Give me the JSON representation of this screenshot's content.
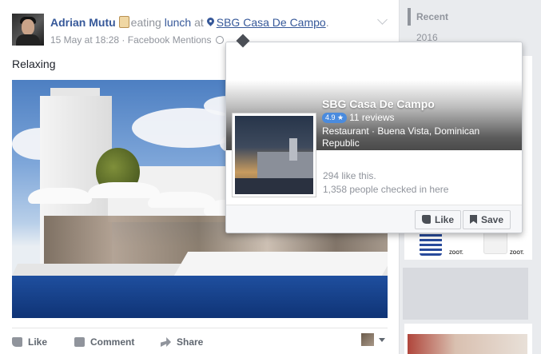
{
  "post": {
    "author": "Adrian Mutu",
    "activity": "eating",
    "activity_object": "lunch",
    "at_word": "at",
    "place": "SBG Casa De Campo",
    "period": ".",
    "timestamp": "15 May at 18:28",
    "separator": " · ",
    "source": "Facebook Mentions",
    "message": "Relaxing",
    "actions": {
      "like": "Like",
      "comment": "Comment",
      "share": "Share"
    }
  },
  "hover_card": {
    "name": "SBG Casa De Campo",
    "rating": "4.9 ★",
    "reviews": "11 reviews",
    "category": "Restaurant · Buena Vista, Dominican Republic",
    "likes": "294 like this.",
    "checkins": "1,358 people checked in here",
    "like_button": "Like",
    "save_button": "Save"
  },
  "rail": {
    "recent_label": "Recent",
    "year": "2016",
    "ad_brand_1": "ZOOT.",
    "ad_brand_2": "ZOOT."
  },
  "colors": {
    "link": "#365899",
    "muted": "#90949c",
    "rating_badge": "#4a8bde"
  }
}
